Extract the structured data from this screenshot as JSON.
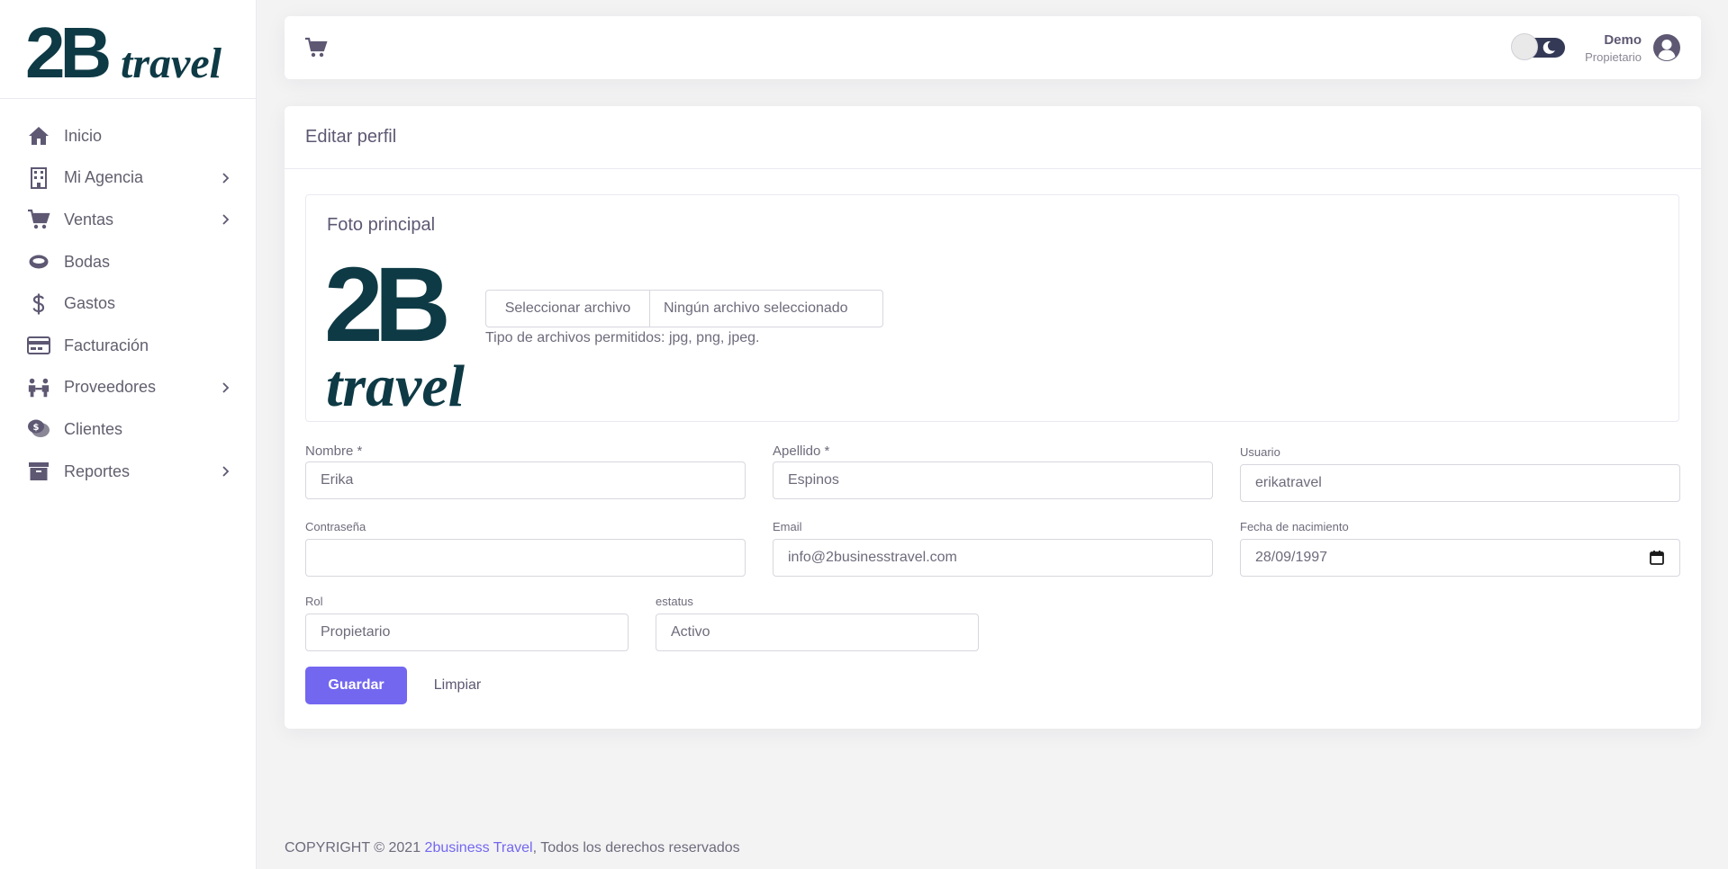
{
  "brand": {
    "logo_text_big": "2B",
    "logo_text_script": "travel",
    "color": "#0e3a45"
  },
  "sidebar": {
    "items": [
      {
        "label": "Inicio",
        "icon": "home-icon",
        "has_children": false
      },
      {
        "label": "Mi Agencia",
        "icon": "building-icon",
        "has_children": true
      },
      {
        "label": "Ventas",
        "icon": "cart-icon",
        "has_children": true
      },
      {
        "label": "Bodas",
        "icon": "ring-icon",
        "has_children": false
      },
      {
        "label": "Gastos",
        "icon": "dollar-icon",
        "has_children": false
      },
      {
        "label": "Facturación",
        "icon": "credit-card-icon",
        "has_children": false
      },
      {
        "label": "Proveedores",
        "icon": "people-icon",
        "has_children": true
      },
      {
        "label": "Clientes",
        "icon": "chat-dollar-icon",
        "has_children": false
      },
      {
        "label": "Reportes",
        "icon": "archive-icon",
        "has_children": true
      }
    ]
  },
  "topbar": {
    "cart_icon": "cart-icon",
    "user_name": "Demo",
    "user_role": "Propietario"
  },
  "card": {
    "title": "Editar perfil",
    "photo": {
      "title": "Foto principal",
      "file_button": "Seleccionar archivo",
      "file_status": "Ningún archivo seleccionado",
      "hint": "Tipo de archivos permitidos: jpg, png, jpeg."
    },
    "fields": {
      "nombre": {
        "label": "Nombre *",
        "value": "Erika"
      },
      "apellido": {
        "label": "Apellido *",
        "value": "Espinos"
      },
      "usuario": {
        "label": "Usuario",
        "value": "erikatravel"
      },
      "contrasena": {
        "label": "Contraseña",
        "value": ""
      },
      "email": {
        "label": "Email",
        "value": "info@2businesstravel.com"
      },
      "fecha": {
        "label": "Fecha de nacimiento",
        "value": "28/09/1997"
      },
      "rol": {
        "label": "Rol",
        "value": "Propietario"
      },
      "estatus": {
        "label": "estatus",
        "value": "Activo"
      }
    },
    "save_label": "Guardar",
    "clear_label": "Limpiar"
  },
  "footer": {
    "prefix": "COPYRIGHT © 2021 ",
    "link": "2business Travel",
    "suffix": ", Todos los derechos reservados"
  },
  "colors": {
    "primary": "#7367f0",
    "text": "#6e6b7b",
    "heading": "#5e5873",
    "toggle_track": "#343a56"
  }
}
